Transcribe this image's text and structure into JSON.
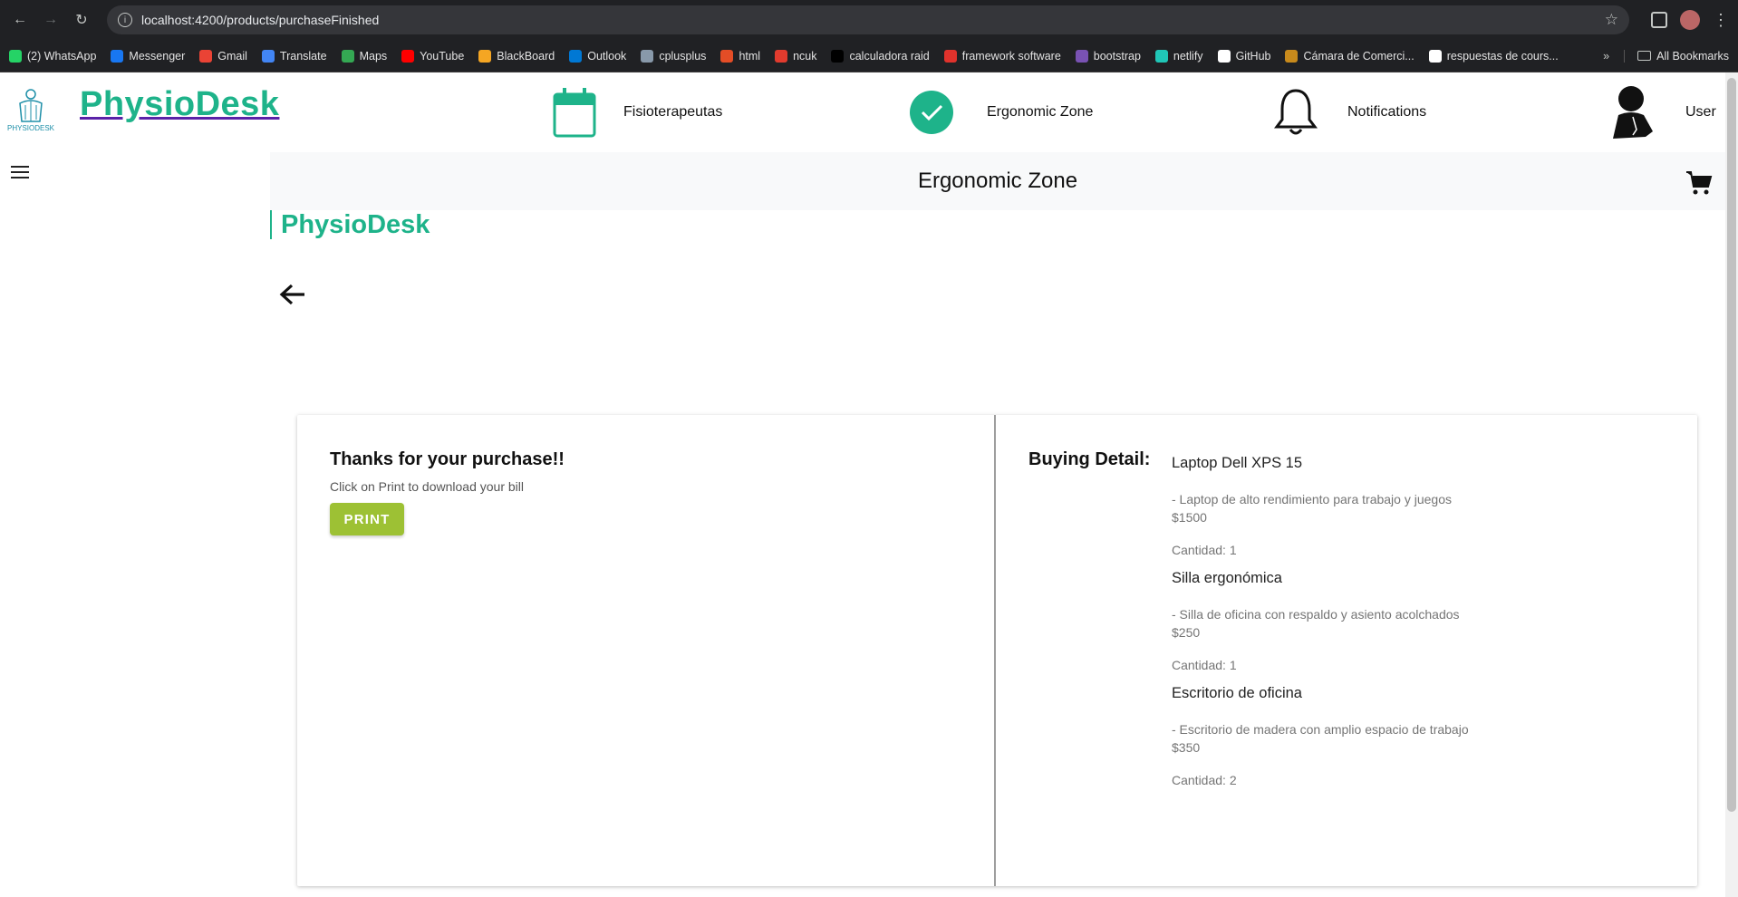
{
  "browser": {
    "url": "localhost:4200/products/purchaseFinished",
    "bookmarks": [
      {
        "label": "(2) WhatsApp",
        "color": "#25d366"
      },
      {
        "label": "Messenger",
        "color": "#1877f2"
      },
      {
        "label": "Gmail",
        "color": "#ea4335"
      },
      {
        "label": "Translate",
        "color": "#4285f4"
      },
      {
        "label": "Maps",
        "color": "#34a853"
      },
      {
        "label": "YouTube",
        "color": "#ff0000"
      },
      {
        "label": "BlackBoard",
        "color": "#f5a623"
      },
      {
        "label": "Outlook",
        "color": "#0078d4"
      },
      {
        "label": "cplusplus",
        "color": "#8899aa"
      },
      {
        "label": "html",
        "color": "#e44d26"
      },
      {
        "label": "ncuk",
        "color": "#e23b2e"
      },
      {
        "label": "calculadora raid",
        "color": "#000000"
      },
      {
        "label": "framework software",
        "color": "#e0322c"
      },
      {
        "label": "bootstrap",
        "color": "#7952b3"
      },
      {
        "label": "netlify",
        "color": "#20c6b7"
      },
      {
        "label": "GitHub",
        "color": "#ffffff"
      },
      {
        "label": "Cámara de Comerci...",
        "color": "#c88a1c"
      },
      {
        "label": "respuestas de cours...",
        "color": "#ffffff"
      }
    ],
    "all_bookmarks": "All Bookmarks"
  },
  "header": {
    "brand": "PhysioDesk",
    "nav": {
      "physios": "Fisioterapeutas",
      "ergonomic": "Ergonomic Zone",
      "notifications": "Notifications",
      "user": "User"
    },
    "colors": {
      "accent": "#1eb38a",
      "underline": "#5a22a8"
    }
  },
  "toolbar": {
    "title": "Ergonomic Zone"
  },
  "section": {
    "brand": "PhysioDesk"
  },
  "purchase": {
    "thanks": "Thanks for your purchase!!",
    "subtitle": "Click on Print to download your bill",
    "print_label": "PRINT",
    "detail_label": "Buying Detail:",
    "items": [
      {
        "name": "Laptop Dell XPS 15",
        "desc": "- Laptop de alto rendimiento para trabajo y juegos",
        "price": "$1500",
        "qty": "Cantidad: 1"
      },
      {
        "name": "Silla ergonómica",
        "desc": "- Silla de oficina con respaldo y asiento acolchados",
        "price": "$250",
        "qty": "Cantidad: 1"
      },
      {
        "name": "Escritorio de oficina",
        "desc": "- Escritorio de madera con amplio espacio de trabajo",
        "price": "$350",
        "qty": "Cantidad: 2"
      }
    ]
  }
}
